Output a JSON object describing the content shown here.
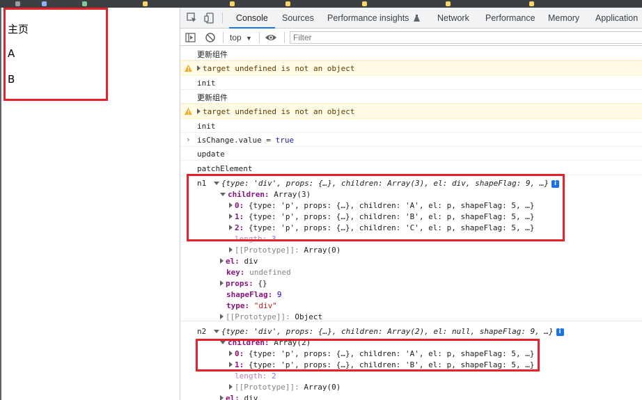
{
  "page": {
    "lines": [
      "主页",
      "A",
      "B"
    ]
  },
  "devtools": {
    "tabs": [
      "Console",
      "Sources",
      "Performance insights",
      "Network",
      "Performance",
      "Memory",
      "Application"
    ],
    "active_tab": "Console",
    "context": "top",
    "filter_placeholder": "Filter"
  },
  "console": {
    "rows": [
      {
        "type": "log",
        "text": "更新组件"
      },
      {
        "type": "warn",
        "text": "target undefined is not an object"
      },
      {
        "type": "log",
        "text": "init"
      },
      {
        "type": "log",
        "text": "更新组件"
      },
      {
        "type": "warn",
        "text": "target undefined is not an object"
      },
      {
        "type": "log",
        "text": "init"
      },
      {
        "type": "input",
        "text_a": "isChange.value = ",
        "text_b": "true"
      },
      {
        "type": "log",
        "text": "update"
      },
      {
        "type": "log",
        "text": "patchElement"
      }
    ],
    "n1": {
      "label": "n1",
      "summary": "{type: 'div', props: {…}, children: Array(3), el: div, shapeFlag: 9, …}",
      "children_key": "children:",
      "children_val": "Array(3)",
      "items": [
        {
          "idx": "0:",
          "val": "{type: 'p', props: {…}, children: 'A', el: p, shapeFlag: 5, …}"
        },
        {
          "idx": "1:",
          "val": "{type: 'p', props: {…}, children: 'B', el: p, shapeFlag: 5, …}"
        },
        {
          "idx": "2:",
          "val": "{type: 'p', props: {…}, children: 'C', el: p, shapeFlag: 5, …}"
        }
      ],
      "length_key": "length:",
      "length_val": "3",
      "proto_arr_key": "[[Prototype]]:",
      "proto_arr_val": "Array(0)",
      "el_key": "el:",
      "el_val": "div",
      "key_key": "key:",
      "key_val": "undefined",
      "props_key": "props:",
      "props_val": "{}",
      "shapeflag_key": "shapeFlag:",
      "shapeflag_val": "9",
      "type_key": "type:",
      "type_val": "\"div\"",
      "proto_obj_key": "[[Prototype]]:",
      "proto_obj_val": "Object"
    },
    "n2": {
      "label": "n2",
      "summary": "{type: 'div', props: {…}, children: Array(2), el: null, shapeFlag: 9, …}",
      "children_key": "children:",
      "children_val": "Array(2)",
      "items": [
        {
          "idx": "0:",
          "val": "{type: 'p', props: {…}, children: 'A', el: p, shapeFlag: 5, …}"
        },
        {
          "idx": "1:",
          "val": "{type: 'p', props: {…}, children: 'B', el: p, shapeFlag: 5, …}"
        }
      ],
      "length_key": "length:",
      "length_val": "2",
      "proto_arr_key": "[[Prototype]]:",
      "proto_arr_val": "Array(0)",
      "el_key": "el:",
      "el_val": "div"
    }
  },
  "colors": {
    "highlight": "#e8202a",
    "accent": "#1a73e8",
    "warn_bg": "#fffbe5"
  }
}
